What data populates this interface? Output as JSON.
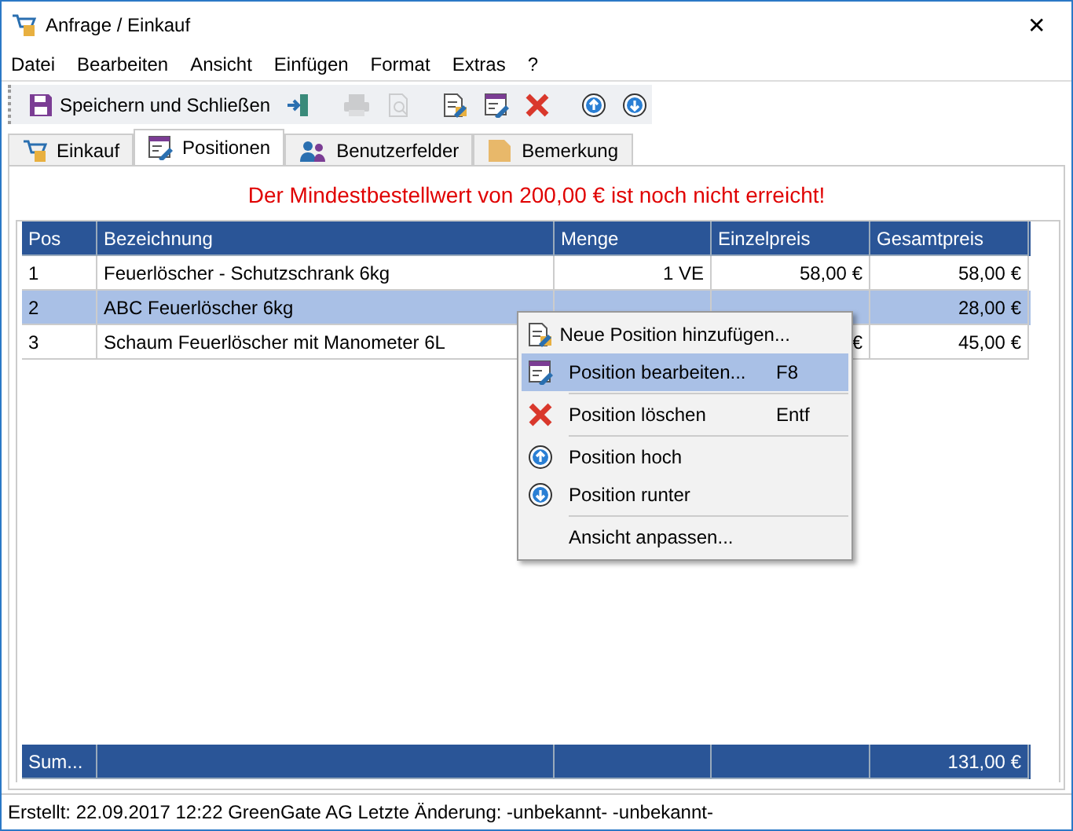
{
  "window": {
    "title": "Anfrage / Einkauf",
    "close": "✕"
  },
  "menu": [
    "Datei",
    "Bearbeiten",
    "Ansicht",
    "Einfügen",
    "Format",
    "Extras",
    "?"
  ],
  "toolbar": [
    {
      "kind": "save",
      "label": "Speichern und Schließen",
      "disabled": false
    },
    {
      "kind": "exit",
      "disabled": false
    },
    {
      "kind": "sep"
    },
    {
      "kind": "print",
      "disabled": true
    },
    {
      "kind": "preview",
      "disabled": true
    },
    {
      "kind": "sep"
    },
    {
      "kind": "new",
      "disabled": false
    },
    {
      "kind": "edit",
      "disabled": false
    },
    {
      "kind": "delete",
      "disabled": false
    },
    {
      "kind": "sep"
    },
    {
      "kind": "up",
      "disabled": false
    },
    {
      "kind": "down",
      "disabled": false
    }
  ],
  "tabs": [
    {
      "kind": "cart",
      "label": "Einkauf",
      "selected": false
    },
    {
      "kind": "edit",
      "label": "Positionen",
      "selected": true
    },
    {
      "kind": "users",
      "label": "Benutzerfelder",
      "selected": false
    },
    {
      "kind": "note",
      "label": "Bemerkung",
      "selected": false
    }
  ],
  "warning": "Der Mindestbestellwert von 200,00 € ist noch nicht erreicht!",
  "table": {
    "columns": [
      "Pos",
      "Bezeichnung",
      "Menge",
      "Einzelpreis",
      "Gesamtpreis"
    ],
    "rows": [
      {
        "selected": false,
        "cells": [
          "1",
          "Feuerlöscher - Schutzschrank 6kg",
          "1 VE",
          "58,00 €",
          "58,00 €"
        ]
      },
      {
        "selected": true,
        "cells": [
          "2",
          "ABC Feuerlöscher  6kg",
          null,
          null,
          "28,00 €"
        ]
      },
      {
        "selected": false,
        "cells": [
          "3",
          "Schaum Feuerlöscher mit Manometer 6L",
          null,
          "€",
          "45,00 €"
        ]
      }
    ],
    "sum_row": {
      "label": "Sum...",
      "total": "131,00 €"
    }
  },
  "context_menu": [
    {
      "kind": "new",
      "label": "Neue Position hinzufügen...",
      "selected": false
    },
    {
      "kind": "edit",
      "label": "Position bearbeiten...",
      "shortcut": "F8",
      "selected": true
    },
    {
      "kind": "delete",
      "label": "Position löschen",
      "shortcut": "Entf",
      "selected": false
    },
    {
      "kind": "up",
      "label": "Position hoch",
      "selected": false
    },
    {
      "kind": "down",
      "label": "Position runter",
      "selected": false
    },
    {
      "kind": "view",
      "label": "Ansicht anpassen...",
      "selected": false
    }
  ],
  "status_bar": "Erstellt: 22.09.2017 12:22 GreenGate AG  Letzte Änderung: -unbekannt- -unbekannt-"
}
